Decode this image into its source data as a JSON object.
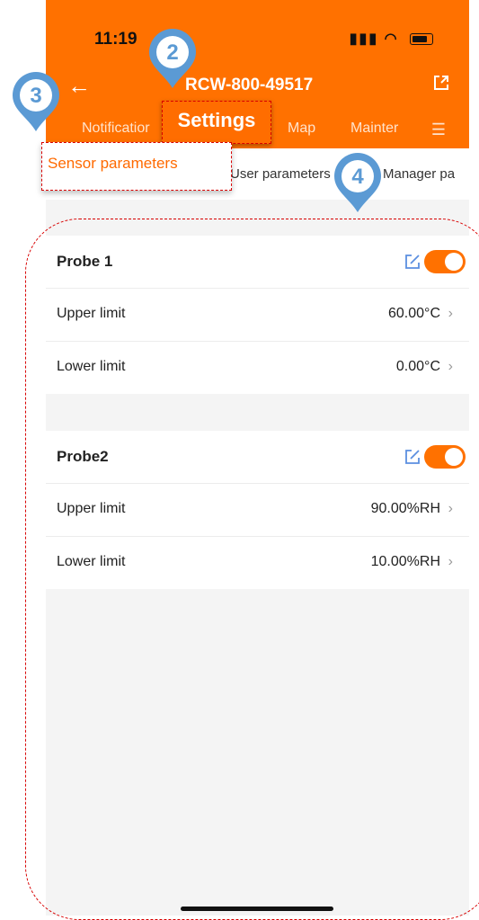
{
  "status_bar": {
    "time": "11:19"
  },
  "header": {
    "title": "RCW-800-49517",
    "tabs": [
      "Notificatior",
      "Settings",
      "Map",
      "Mainter"
    ]
  },
  "subtabs": [
    "Sensor parameters",
    "User parameters",
    "Manager pa"
  ],
  "probes": [
    {
      "name": "Probe 1",
      "enabled": true,
      "rows": [
        {
          "label": "Upper limit",
          "value": "60.00°C"
        },
        {
          "label": "Lower limit",
          "value": "0.00°C"
        }
      ]
    },
    {
      "name": "Probe2",
      "enabled": true,
      "rows": [
        {
          "label": "Upper limit",
          "value": "90.00%RH"
        },
        {
          "label": "Lower limit",
          "value": "10.00%RH"
        }
      ]
    }
  ],
  "markers": [
    "2",
    "3",
    "4"
  ],
  "colors": {
    "brand": "#ff7100",
    "annotation_red": "#d80000",
    "marker_blue": "#5b9ad4"
  }
}
